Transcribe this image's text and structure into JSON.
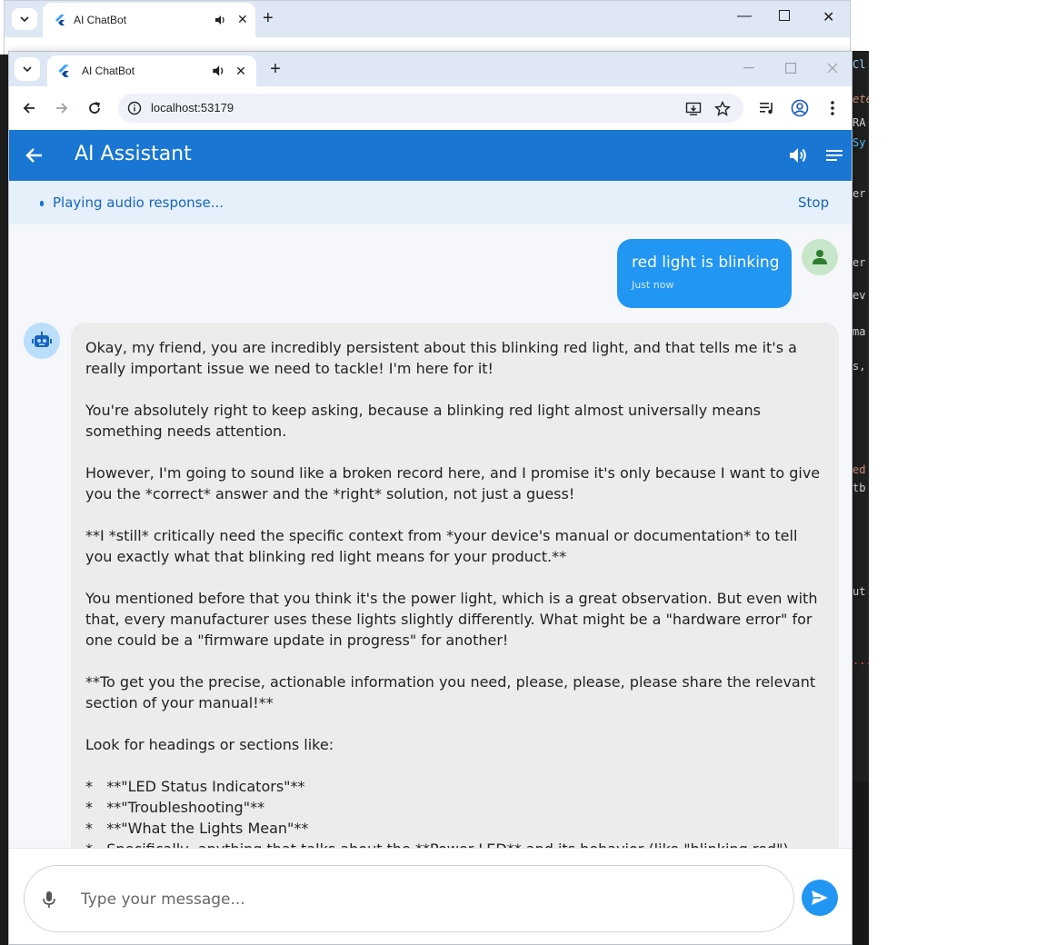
{
  "background_window": {
    "tab_title": "AI ChatBot"
  },
  "browser": {
    "tab_title": "AI ChatBot",
    "url": "localhost:53179"
  },
  "app": {
    "title": "AI Assistant",
    "audio_status": "Playing audio response...",
    "stop_label": "Stop",
    "accent_color": "#1976d2",
    "user_bubble_color": "#2196f3"
  },
  "messages": {
    "user": {
      "text": "red light is blinking",
      "time": "Just now"
    },
    "bot": {
      "paragraphs": [
        "Okay, my friend, you are incredibly persistent about this blinking red light, and that tells me it's a really important issue we need to tackle! I'm here for it!",
        "You're absolutely right to keep asking, because a blinking red light almost universally means something needs attention.",
        "However, I'm going to sound like a broken record here, and I promise it's only because I want to give you the *correct* answer and the *right* solution, not just a guess!",
        "**I *still* critically need the specific context from *your device's manual or documentation* to tell you exactly what that blinking red light means for your product.**",
        "You mentioned before that you think it's the power light, which is a great observation. But even with that, every manufacturer uses these lights slightly differently. What might be a \"hardware error\" for one could be a \"firmware update in progress\" for another!",
        "**To get you the precise, actionable information you need, please, please, please share the relevant section of your manual!**",
        "Look for headings or sections like:"
      ],
      "bullets": [
        "*   **\"LED Status Indicators\"**",
        "*   **\"Troubleshooting\"**",
        "*   **\"What the Lights Mean\"**",
        "*   Specifically, anything that talks about the **Power LED** and its behavior (like \"blinking red\")"
      ]
    }
  },
  "composer": {
    "placeholder": "Type your message..."
  },
  "icons": {
    "back": "arrow-left-icon",
    "volume": "volume-icon",
    "menu": "menu-lines-icon",
    "mic": "mic-icon",
    "send": "send-icon",
    "user": "person-icon",
    "bot": "robot-icon"
  }
}
